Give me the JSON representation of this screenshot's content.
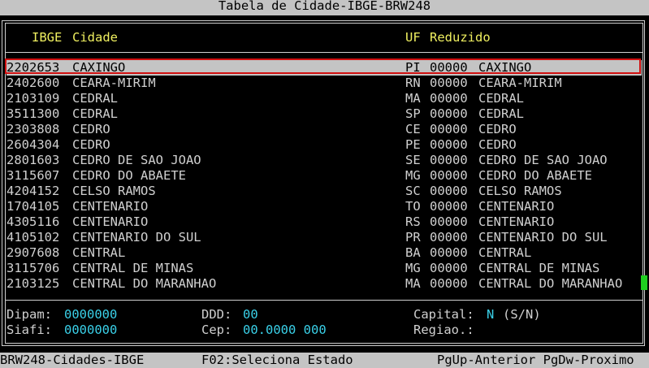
{
  "window": {
    "title": "Tabela de Cidade-IBGE-BRW248"
  },
  "table": {
    "headers": {
      "ibge": "IBGE",
      "cidade": "Cidade",
      "uf": "UF",
      "reduzido": "Reduzido"
    },
    "rows": [
      {
        "ibge": "2202653",
        "cidade": "CAXINGO",
        "uf": "PI",
        "codigo": "00000",
        "reduzido": "CAXINGO"
      },
      {
        "ibge": "2402600",
        "cidade": "CEARA-MIRIM",
        "uf": "RN",
        "codigo": "00000",
        "reduzido": "CEARA-MIRIM"
      },
      {
        "ibge": "2103109",
        "cidade": "CEDRAL",
        "uf": "MA",
        "codigo": "00000",
        "reduzido": "CEDRAL"
      },
      {
        "ibge": "3511300",
        "cidade": "CEDRAL",
        "uf": "SP",
        "codigo": "00000",
        "reduzido": "CEDRAL"
      },
      {
        "ibge": "2303808",
        "cidade": "CEDRO",
        "uf": "CE",
        "codigo": "00000",
        "reduzido": "CEDRO"
      },
      {
        "ibge": "2604304",
        "cidade": "CEDRO",
        "uf": "PE",
        "codigo": "00000",
        "reduzido": "CEDRO"
      },
      {
        "ibge": "2801603",
        "cidade": "CEDRO DE SAO JOAO",
        "uf": "SE",
        "codigo": "00000",
        "reduzido": "CEDRO DE SAO JOAO"
      },
      {
        "ibge": "3115607",
        "cidade": "CEDRO DO ABAETE",
        "uf": "MG",
        "codigo": "00000",
        "reduzido": "CEDRO DO ABAETE"
      },
      {
        "ibge": "4204152",
        "cidade": "CELSO RAMOS",
        "uf": "SC",
        "codigo": "00000",
        "reduzido": "CELSO RAMOS"
      },
      {
        "ibge": "1704105",
        "cidade": "CENTENARIO",
        "uf": "TO",
        "codigo": "00000",
        "reduzido": "CENTENARIO"
      },
      {
        "ibge": "4305116",
        "cidade": "CENTENARIO",
        "uf": "RS",
        "codigo": "00000",
        "reduzido": "CENTENARIO"
      },
      {
        "ibge": "4105102",
        "cidade": "CENTENARIO DO SUL",
        "uf": "PR",
        "codigo": "00000",
        "reduzido": "CENTENARIO DO SUL"
      },
      {
        "ibge": "2907608",
        "cidade": "CENTRAL",
        "uf": "BA",
        "codigo": "00000",
        "reduzido": "CENTRAL"
      },
      {
        "ibge": "3115706",
        "cidade": "CENTRAL DE MINAS",
        "uf": "MG",
        "codigo": "00000",
        "reduzido": "CENTRAL DE MINAS"
      },
      {
        "ibge": "2103125",
        "cidade": "CENTRAL DO MARANHAO",
        "uf": "MA",
        "codigo": "00000",
        "reduzido": "CENTRAL DO MARANHAO"
      }
    ]
  },
  "details": {
    "dipam": {
      "label": "Dipam:",
      "value": "0000000"
    },
    "siafi": {
      "label": "Siafi:",
      "value": "0000000"
    },
    "ddd": {
      "label": "DDD:",
      "value": "00"
    },
    "cep": {
      "label": "Cep:",
      "value": "00.0000 000"
    },
    "capital": {
      "label": "Capital:",
      "value": "N",
      "hint": "(S/N)"
    },
    "regiao": {
      "label": "Regiao.:",
      "value": ""
    }
  },
  "statusbar": {
    "program": "BRW248-Cidades-IBGE",
    "f02": "F02:Seleciona Estado",
    "paging": "PgUp-Anterior PgDw-Proximo"
  },
  "colors": {
    "background": "#000000",
    "text": "#d0d0d0",
    "header_text": "#f0f060",
    "value_text": "#3ad0e8",
    "bar_background": "#c4c4c4",
    "selection_outline": "#d01010",
    "cursor_marker": "#20d020"
  }
}
